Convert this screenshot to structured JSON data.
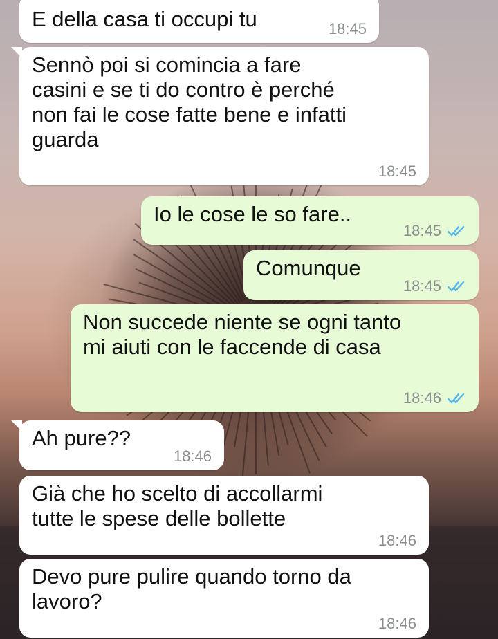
{
  "colors": {
    "incoming_bubble": "#ffffff",
    "outgoing_bubble": "#e8fbd7",
    "timestamp": "#8b8f8e",
    "read_ticks": "#4fb6ec"
  },
  "messages": [
    {
      "direction": "incoming",
      "text": "E della casa ti occupi tu",
      "time": "18:45"
    },
    {
      "direction": "incoming",
      "text": "Sennò poi si comincia a fare\ncasini e se ti do contro è perché\nnon fai le cose fatte bene e infatti\nguarda",
      "time": "18:45"
    },
    {
      "direction": "outgoing",
      "text": "Io le cose le so fare..",
      "time": "18:45",
      "status_icon": "double-check-read-icon"
    },
    {
      "direction": "outgoing",
      "text": "Comunque",
      "time": "18:45",
      "status_icon": "double-check-read-icon"
    },
    {
      "direction": "outgoing",
      "text": "Non succede niente se ogni tanto\nmi aiuti con le faccende di casa",
      "time": "18:46",
      "status_icon": "double-check-read-icon"
    },
    {
      "direction": "incoming",
      "text": "Ah pure??",
      "time": "18:46"
    },
    {
      "direction": "incoming",
      "text": "Già che ho scelto di accollarmi\ntutte le spese delle bollette",
      "time": "18:46"
    },
    {
      "direction": "incoming",
      "text": "Devo pure pulire quando torno da\nlavoro?",
      "time": "18:46"
    }
  ]
}
